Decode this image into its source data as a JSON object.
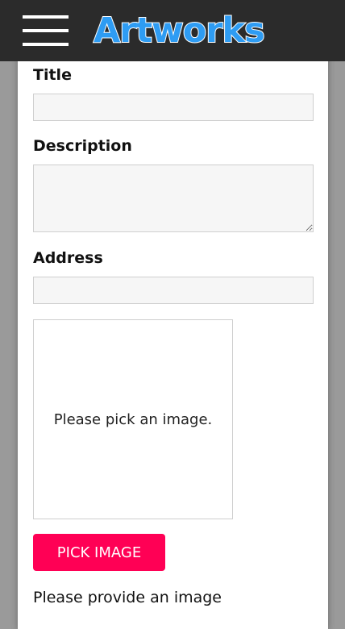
{
  "header": {
    "app_title": "Artworks",
    "menu_icon": "hamburger-menu-icon",
    "background_color": "#2b2b2b",
    "title_color": "#2e9cf3"
  },
  "form": {
    "title_label": "Title",
    "title_value": "",
    "description_label": "Description",
    "description_value": "",
    "address_label": "Address",
    "address_value": "",
    "image_placeholder": "Please pick an image.",
    "pick_image_label": "PICK IMAGE",
    "pick_image_color": "#ff0055",
    "validation_message": "Please provide an image"
  }
}
